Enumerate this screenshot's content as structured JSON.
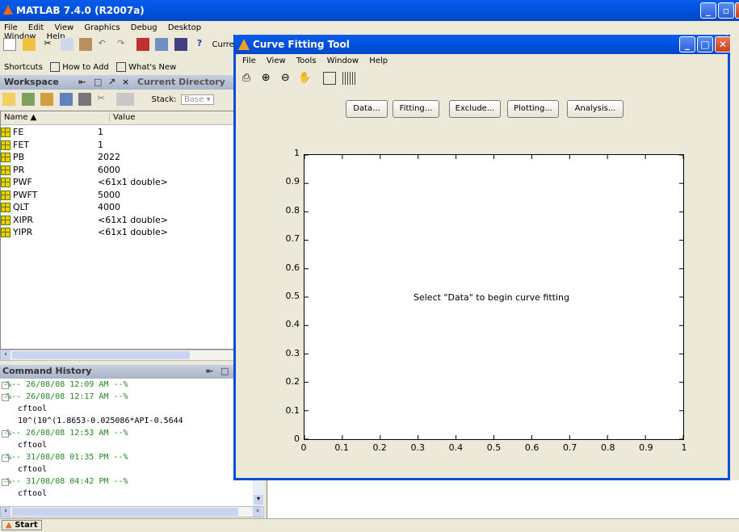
{
  "main_window": {
    "title": "MATLAB  7.4.0 (R2007a)",
    "menu": [
      "File",
      "Edit",
      "View",
      "Graphics",
      "Debug",
      "Desktop",
      "Window",
      "Help"
    ],
    "current_dir_label": "Curre",
    "shortcuts": {
      "label": "Shortcuts",
      "how_to_add": "How to Add",
      "whats_new": "What's New"
    }
  },
  "workspace": {
    "title": "Workspace",
    "tab_current_directory": "Current Directory",
    "stack_label": "Stack:",
    "stack_value": "Base",
    "columns": {
      "name": "Name ▲",
      "value": "Value"
    },
    "rows": [
      {
        "name": "FE",
        "value": "1"
      },
      {
        "name": "FET",
        "value": "1"
      },
      {
        "name": "PB",
        "value": "2022"
      },
      {
        "name": "PR",
        "value": "6000"
      },
      {
        "name": "PWF",
        "value": "<61x1 double>"
      },
      {
        "name": "PWFT",
        "value": "5000"
      },
      {
        "name": "QLT",
        "value": "4000"
      },
      {
        "name": "XIPR",
        "value": "<61x1 double>"
      },
      {
        "name": "YIPR",
        "value": "<61x1 double>"
      }
    ]
  },
  "command_history": {
    "title": "Command History",
    "lines": [
      {
        "text": "%-- 26/08/08 12:09 AM --%",
        "type": "session"
      },
      {
        "text": "%-- 26/08/08 12:17 AM --%",
        "type": "session"
      },
      {
        "text": "cftool",
        "type": "cmd"
      },
      {
        "text": "10^(10^(1.8653-0.025086*API-0.5644",
        "type": "cmd"
      },
      {
        "text": "%-- 26/08/08 12:53 AM --%",
        "type": "session"
      },
      {
        "text": "cftool",
        "type": "cmd"
      },
      {
        "text": "%-- 31/08/08 01:35 PM --%",
        "type": "session"
      },
      {
        "text": "cftool",
        "type": "cmd"
      },
      {
        "text": "%-- 31/08/08 04:42 PM --%",
        "type": "session"
      },
      {
        "text": "cftool",
        "type": "cmd"
      }
    ]
  },
  "cftool": {
    "title": "Curve Fitting Tool",
    "menu": [
      "File",
      "View",
      "Tools",
      "Window",
      "Help"
    ],
    "buttons": [
      "Data...",
      "Fitting...",
      "Exclude...",
      "Plotting...",
      "Analysis..."
    ],
    "plot_message": "Select \"Data\" to begin curve fitting",
    "yticks": [
      "0",
      "0.1",
      "0.2",
      "0.3",
      "0.4",
      "0.5",
      "0.6",
      "0.7",
      "0.8",
      "0.9",
      "1"
    ],
    "xticks": [
      "0",
      "0.1",
      "0.2",
      "0.3",
      "0.4",
      "0.5",
      "0.6",
      "0.7",
      "0.8",
      "0.9",
      "1"
    ]
  },
  "taskbar": {
    "start": "Start"
  }
}
